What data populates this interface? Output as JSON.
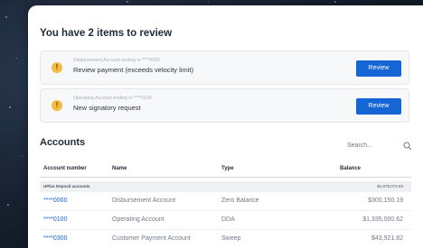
{
  "review": {
    "title": "You have 2 items to review",
    "items": [
      {
        "subtitle": "Disbursement Account ending in ****0000",
        "main": "Review payment (exceeds velocity limit)",
        "button": "Review"
      },
      {
        "subtitle": "Operating Account ending in ****0100",
        "main": "New signatory request",
        "button": "Review"
      }
    ]
  },
  "accounts": {
    "title": "Accounts",
    "search_placeholder": "Search...",
    "columns": [
      "Account number",
      "Name",
      "Type",
      "Balance"
    ],
    "group": {
      "label": "UPlus Deposit accounts",
      "total": "$1,679,072.63"
    },
    "rows": [
      {
        "number": "****0000",
        "name": "Disbursement Account",
        "type": "Zero Balance",
        "balance": "$300,150.19"
      },
      {
        "number": "****0100",
        "name": "Operating Account",
        "type": "DDA",
        "balance": "$1,335,000.62"
      },
      {
        "number": "****0300",
        "name": "Customer Payment Account",
        "type": "Sweep",
        "balance": "$43,921.82"
      }
    ]
  },
  "colors": {
    "accent": "#1665d4",
    "warning": "#f2bb42",
    "background": "#16202f"
  },
  "icons": {
    "warning": "warning-icon",
    "search": "search-icon"
  }
}
